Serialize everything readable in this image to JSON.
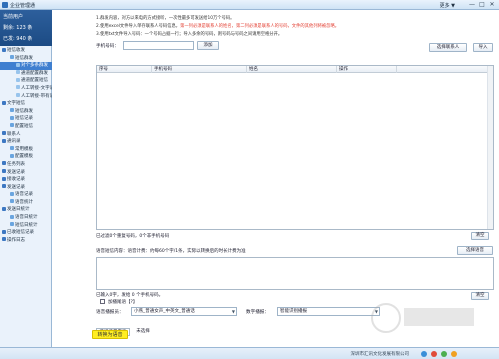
{
  "window": {
    "title": "企业管理通",
    "menu": "更多 ▼",
    "minimize": "—",
    "maximize": "□",
    "close": "✕"
  },
  "user": {
    "current_user_label": "当前用户",
    "balance": "剩余: 123 条",
    "sent": "已发: 940 条"
  },
  "tree": [
    {
      "label": "短信收发",
      "level": 0,
      "selected": false
    },
    {
      "label": "短信群发",
      "level": 1,
      "selected": false
    },
    {
      "label": "对个多条群发",
      "level": 2,
      "selected": true
    },
    {
      "label": "通道配置群发",
      "level": 2,
      "selected": false
    },
    {
      "label": "通道配置短信",
      "level": 2,
      "selected": false
    },
    {
      "label": "人工转接-文字语音群发",
      "level": 2,
      "selected": false
    },
    {
      "label": "人工转接-带有语音群发",
      "level": 2,
      "selected": false
    },
    {
      "label": "文字短信",
      "level": 0,
      "selected": false
    },
    {
      "label": "短信群发",
      "level": 1,
      "selected": false
    },
    {
      "label": "短信记录",
      "level": 1,
      "selected": false
    },
    {
      "label": "配置短信",
      "level": 1,
      "selected": false
    },
    {
      "label": "联系人",
      "level": 0,
      "selected": false
    },
    {
      "label": "通讯录",
      "level": 0,
      "selected": false
    },
    {
      "label": "常用模板",
      "level": 1,
      "selected": false
    },
    {
      "label": "配置模板",
      "level": 1,
      "selected": false
    },
    {
      "label": "任务列表",
      "level": 0,
      "selected": false
    },
    {
      "label": "发送记录",
      "level": 0,
      "selected": false
    },
    {
      "label": "接收记录",
      "level": 0,
      "selected": false
    },
    {
      "label": "发送记录",
      "level": 0,
      "selected": false
    },
    {
      "label": "语音记录",
      "level": 1,
      "selected": false
    },
    {
      "label": "语音统计",
      "level": 1,
      "selected": false
    },
    {
      "label": "发送日统计",
      "level": 0,
      "selected": false
    },
    {
      "label": "语音日统计",
      "level": 1,
      "selected": false
    },
    {
      "label": "短信日统计",
      "level": 1,
      "selected": false
    },
    {
      "label": "已收短信记录",
      "level": 0,
      "selected": false
    },
    {
      "label": "操作日志",
      "level": 0,
      "selected": false
    }
  ],
  "instructions": {
    "line1": "1.群发内容，对方以来电的方式接听，一次性最多可发送给10万个号码。",
    "line2_a": "2.使用excel文件导入单存联系人号码信息，",
    "line2_b": "第一列必须是联系人的姓名，第二列必须是联系人的号码，文件的其他列将被忽略。",
    "line3": "3.使用txt文件导入号码：一个号码占据一行；导入多余的号码，则号码与号码之间请用空格分开。"
  },
  "phone_row": {
    "label": "手机号码：",
    "add_button": "添加",
    "select_contacts": "选择联系人",
    "import": "导入"
  },
  "table": {
    "headers": [
      "序号",
      "手机号码",
      "姓名",
      "操作"
    ]
  },
  "count_note": "已过滤0个重复号码，0个非手机号码",
  "clear_button": "清空",
  "voice_label": "语音短信内容：语音计费：约每60个字/1条，实际以转换后的时长计费为准",
  "select_voice_button": "选择语音",
  "input_note": "已输入0字，发给 0 个手机号码。",
  "clear_button2": "清空",
  "checkbox_label": "加播尾语【?】",
  "voice_anchor_label": "语音播报员：",
  "voice_anchor_value": "小燕_普通女声_中英文_普通话",
  "digit_label": "数字播报：",
  "digit_value": "智能识别播报",
  "tabs": {
    "select_bg": "选择背景音乐",
    "none": "未选择"
  },
  "send_button": "转换为语音",
  "status": {
    "company": "深圳市汇讯文化发展有限公司"
  }
}
